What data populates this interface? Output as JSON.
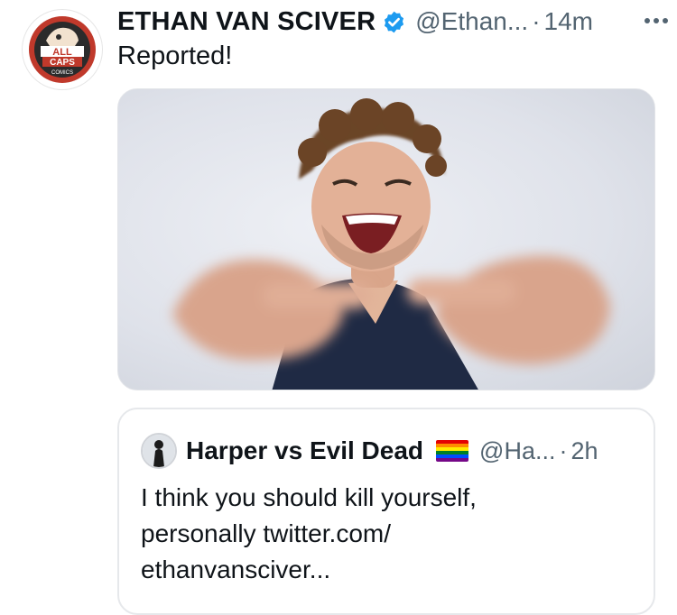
{
  "tweet": {
    "author_name": "ETHAN VAN SCIVER",
    "handle": "@Ethan...",
    "separator": "·",
    "time": "14m",
    "text": "Reported!",
    "avatar_text_top": "ALL",
    "avatar_text_mid": "CAPS",
    "avatar_text_bottom": "COMICS",
    "verified_icon": "verified-badge-icon",
    "more_icon": "more-options-icon",
    "photo_description_icon": "photo-man-pointing"
  },
  "quote": {
    "author_name": "Harper vs Evil Dead",
    "handle": "@Ha...",
    "separator": "·",
    "time": "2h",
    "line1": "I think you should kill yourself,",
    "line2": "personally twitter.com/",
    "line3": "ethanvansciver..."
  },
  "colors": {
    "verified": "#1d9bf0",
    "secondary_text": "#536471",
    "avatar_red": "#c0392b"
  }
}
